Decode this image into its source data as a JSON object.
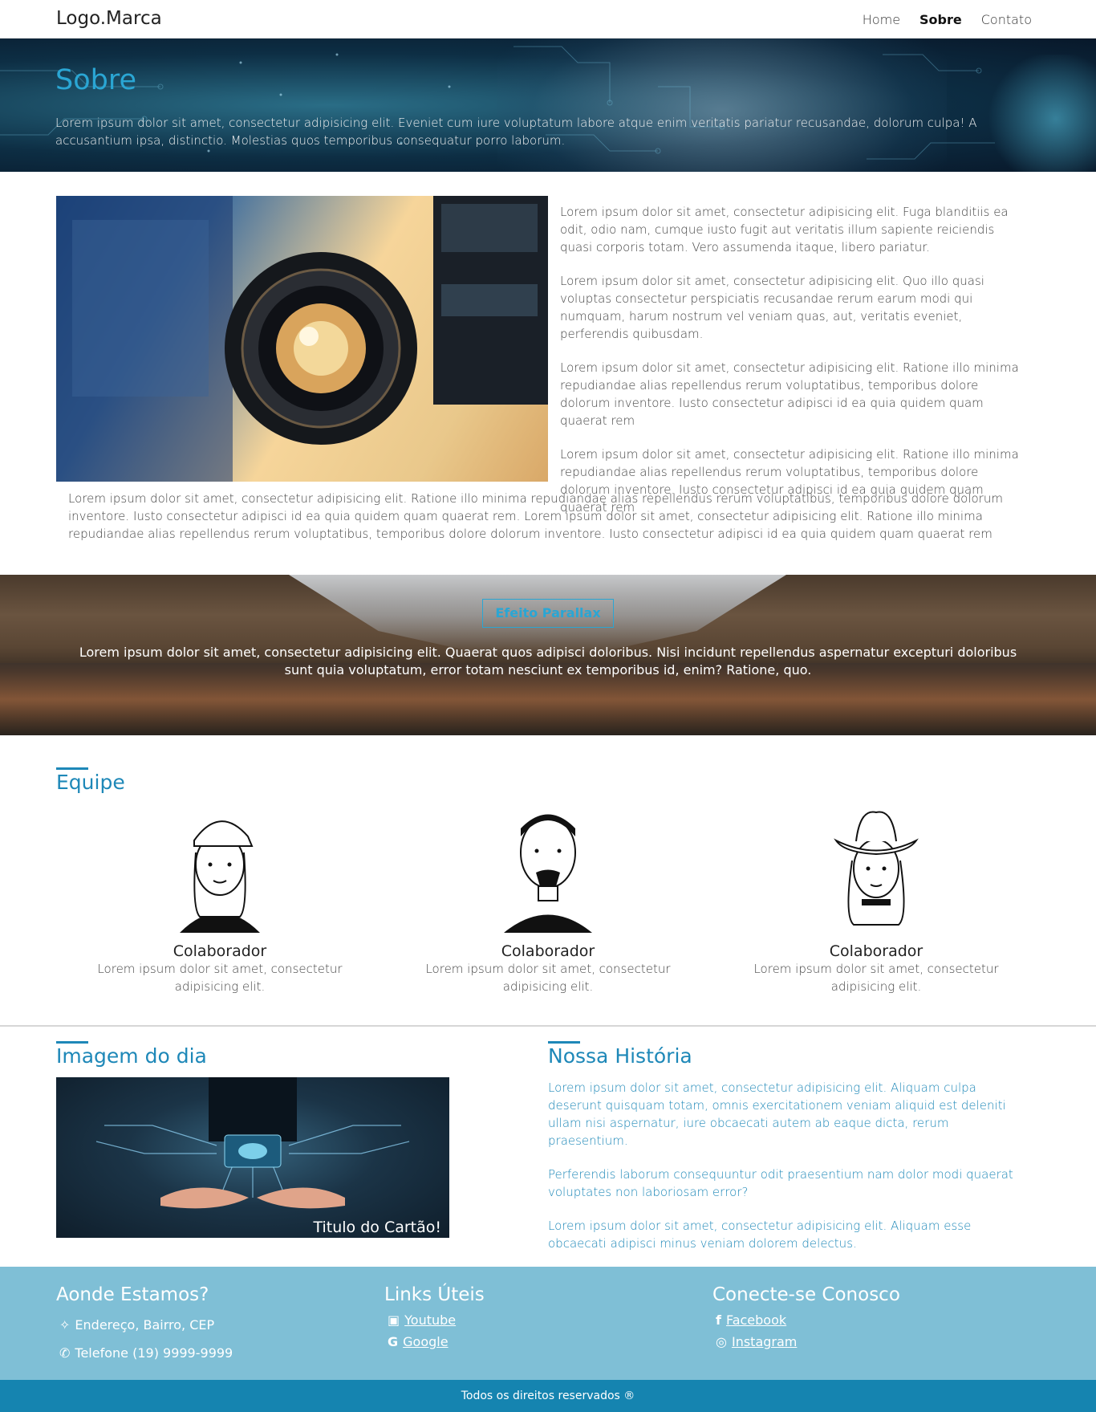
{
  "navbar": {
    "logo": "Logo.Marca",
    "links": [
      "Home",
      "Sobre",
      "Contato"
    ],
    "active": "Sobre"
  },
  "hero": {
    "title": "Sobre",
    "text": "Lorem ipsum dolor sit amet, consectetur adipisicing elit. Eveniet cum iure voluptatum labore atque enim veritatis pariatur recusandae, dolorum culpa! A accusantium ipsa, distinctio. Molestias quos temporibus consequatur porro laborum."
  },
  "about": {
    "paragraphs": [
      "Lorem ipsum dolor sit amet, consectetur adipisicing elit. Fuga blanditiis ea odit, odio nam, cumque iusto fugit aut veritatis illum sapiente reiciendis quasi corporis totam. Vero assumenda itaque, libero pariatur.",
      "Lorem ipsum dolor sit amet, consectetur adipisicing elit. Quo illo quasi voluptas consectetur perspiciatis recusandae rerum earum modi qui numquam, harum nostrum vel veniam quas, aut, veritatis eveniet, perferendis quibusdam.",
      "Lorem ipsum dolor sit amet, consectetur adipisicing elit. Ratione illo minima repudiandae alias repellendus rerum voluptatibus, temporibus dolore dolorum inventore. Iusto consectetur adipisci id ea quia quidem quam quaerat rem",
      "Lorem ipsum dolor sit amet, consectetur adipisicing elit. Ratione illo minima repudiandae alias repellendus rerum voluptatibus, temporibus dolore dolorum inventore. Iusto consectetur adipisci id ea quia quidem quam quaerat rem"
    ],
    "full": "Lorem ipsum dolor sit amet, consectetur adipisicing elit. Ratione illo minima repudiandae alias repellendus rerum voluptatibus, temporibus dolore dolorum inventore. Iusto consectetur adipisci id ea quia quidem quam quaerat rem. Lorem ipsum dolor sit amet, consectetur adipisicing elit. Ratione illo minima repudiandae alias repellendus rerum voluptatibus, temporibus dolore dolorum inventore. Iusto consectetur adipisci id ea quia quidem quam quaerat rem"
  },
  "parallax": {
    "button": "Efeito Parallax",
    "text": "Lorem ipsum dolor sit amet, consectetur adipisicing elit. Quaerat quos adipisci doloribus. Nisi incidunt repellendus aspernatur excepturi doloribus sunt quia voluptatum, error totam nesciunt ex temporibus id, enim? Ratione, quo."
  },
  "team": {
    "title": "Equipe",
    "members": [
      {
        "name": "Colaborador",
        "desc": "Lorem ipsum dolor sit amet, consectetur adipisicing elit."
      },
      {
        "name": "Colaborador",
        "desc": "Lorem ipsum dolor sit amet, consectetur adipisicing elit."
      },
      {
        "name": "Colaborador",
        "desc": "Lorem ipsum dolor sit amet, consectetur adipisicing elit."
      }
    ]
  },
  "image_of_day": {
    "title": "Imagem do dia",
    "caption": "Titulo do Cartão!"
  },
  "history": {
    "title": "Nossa História",
    "paragraphs": [
      "Lorem ipsum dolor sit amet, consectetur adipisicing elit. Aliquam culpa deserunt quisquam totam, omnis exercitationem veniam aliquid est deleniti ullam nisi aspernatur, iure obcaecati autem ab eaque dicta, rerum praesentium.",
      "Perferendis laborum consequuntur odit praesentium nam dolor modi quaerat voluptates non laboriosam error?",
      "Lorem ipsum dolor sit amet, consectetur adipisicing elit. Aliquam esse obcaecati adipisci minus veniam dolorem delectus."
    ]
  },
  "footer": {
    "location": {
      "title": "Aonde Estamos?",
      "address": "Endereço, Bairro, CEP",
      "phone": "Telefone (19) 9999-9999"
    },
    "links": {
      "title": "Links Úteis",
      "youtube": "Youtube",
      "google": "Google"
    },
    "social": {
      "title": "Conecte-se Conosco",
      "facebook": "Facebook",
      "instagram": "Instagram"
    },
    "copyright": "Todos os direitos reservados ®"
  },
  "colors": {
    "accent": "#1e88b8",
    "hero_title": "#2aa6d4",
    "footer_bg": "#7fbfd6",
    "bottom_bar": "#1584b0"
  }
}
